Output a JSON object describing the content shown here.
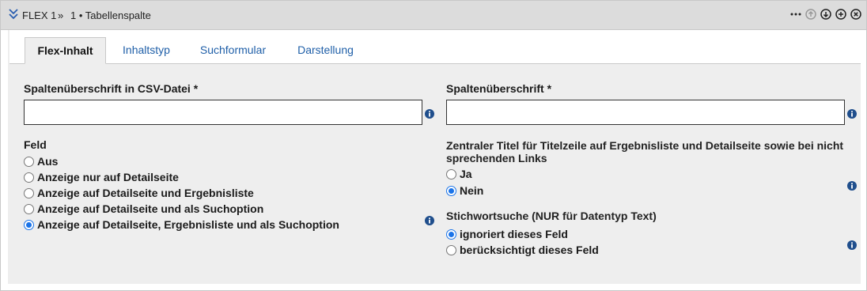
{
  "header": {
    "title": "FLEX 1",
    "separator": "»",
    "subtitle": "1 • Tabellenspalte",
    "icons": [
      "more-icon",
      "move-up-icon",
      "move-down-icon",
      "add-icon",
      "close-icon"
    ]
  },
  "tabs": [
    {
      "label": "Flex-Inhalt",
      "active": true
    },
    {
      "label": "Inhaltstyp",
      "active": false
    },
    {
      "label": "Suchformular",
      "active": false
    },
    {
      "label": "Darstellung",
      "active": false
    }
  ],
  "left": {
    "csv_label": "Spaltenüberschrift in CSV-Datei *",
    "csv_value": "",
    "feld_label": "Feld",
    "feld_options": [
      {
        "label": "Aus",
        "checked": false
      },
      {
        "label": "Anzeige nur auf Detailseite",
        "checked": false
      },
      {
        "label": "Anzeige auf Detailseite und Ergebnisliste",
        "checked": false
      },
      {
        "label": "Anzeige auf Detailseite und als Suchoption",
        "checked": false
      },
      {
        "label": "Anzeige auf Detailseite, Ergebnisliste und als Suchoption",
        "checked": true
      }
    ]
  },
  "right": {
    "header_label": "Spaltenüberschrift *",
    "header_value": "",
    "title_label_line1": "Zentraler Titel für Titelzeile auf Ergebnisliste und Detailseite sowie bei nicht",
    "title_label_line2": "sprechenden Links",
    "title_options": [
      {
        "label": "Ja",
        "checked": false
      },
      {
        "label": "Nein",
        "checked": true
      }
    ],
    "keyword_label": "Stichwortsuche (NUR für Datentyp Text)",
    "keyword_options": [
      {
        "label": "ignoriert dieses Feld",
        "checked": true
      },
      {
        "label": "berücksichtigt dieses Feld",
        "checked": false
      }
    ]
  },
  "colors": {
    "header_bg": "#dcdcdc",
    "content_bg": "#eeeeee",
    "tab_link": "#1f5fa8",
    "radio_checked": "#1a73e8"
  }
}
